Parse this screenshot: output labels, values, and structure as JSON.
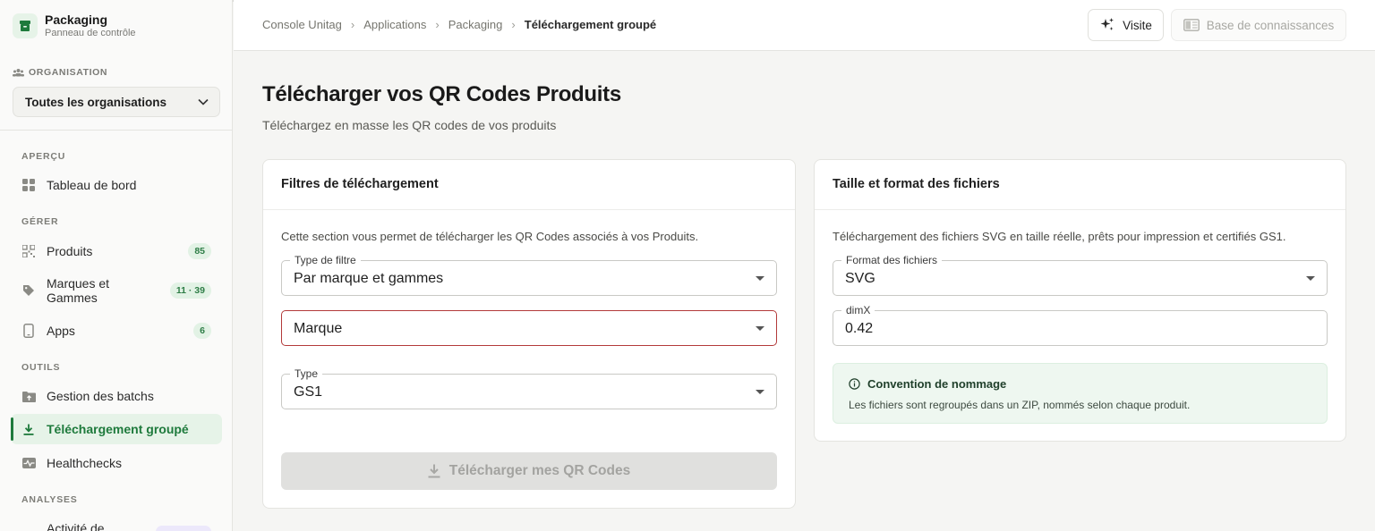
{
  "brand": {
    "name": "Packaging",
    "subtitle": "Panneau de contrôle"
  },
  "organisation": {
    "label": "ORGANISATION",
    "selected": "Toutes les organisations"
  },
  "sidebar": {
    "sections": [
      {
        "label": "APERÇU"
      },
      {
        "label": "GÉRER"
      },
      {
        "label": "OUTILS"
      },
      {
        "label": "ANALYSES"
      }
    ],
    "items": [
      {
        "label": "Tableau de bord",
        "icon": "grid-icon"
      },
      {
        "label": "Produits",
        "icon": "qr-code-icon",
        "badge": "85"
      },
      {
        "label": "Marques et Gammes",
        "icon": "tag-icon",
        "badge": "11 · 39"
      },
      {
        "label": "Apps",
        "icon": "smartphone-icon",
        "badge": "6"
      },
      {
        "label": "Gestion des batchs",
        "icon": "folder-upload-icon"
      },
      {
        "label": "Téléchargement groupé",
        "icon": "download-icon",
        "active": true
      },
      {
        "label": "Healthchecks",
        "icon": "pulse-icon"
      },
      {
        "label": "Activité de",
        "icon": "activity-icon"
      }
    ]
  },
  "header": {
    "breadcrumb": [
      "Console Unitag",
      "Applications",
      "Packaging",
      "Téléchargement groupé"
    ],
    "visit_label": "Visite",
    "kb_label": "Base de connaissances"
  },
  "main": {
    "title": "Télécharger vos QR Codes Produits",
    "subtitle": "Téléchargez en masse les QR codes de vos produits"
  },
  "filters_card": {
    "title": "Filtres de téléchargement",
    "description": "Cette section vous permet de télécharger les QR Codes associés à vos Produits.",
    "filter_type": {
      "label": "Type de filtre",
      "value": "Par marque et gammes"
    },
    "brand": {
      "value": "Marque"
    },
    "type": {
      "label": "Type",
      "value": "GS1"
    },
    "download_label": "Télécharger mes QR Codes"
  },
  "format_card": {
    "title": "Taille et format des fichiers",
    "description": "Téléchargement des fichiers SVG en taille réelle, prêts pour impression et certifiés GS1.",
    "format": {
      "label": "Format des fichiers",
      "value": "SVG"
    },
    "dimx": {
      "label": "dimX",
      "value": "0.42"
    },
    "naming": {
      "title": "Convention de nommage",
      "text": "Les fichiers sont regroupés dans un ZIP, nommés selon chaque produit."
    }
  },
  "colors": {
    "accent": "#1e7a3c",
    "accent_bg": "#e6f3e8",
    "error": "#b33a3a"
  }
}
